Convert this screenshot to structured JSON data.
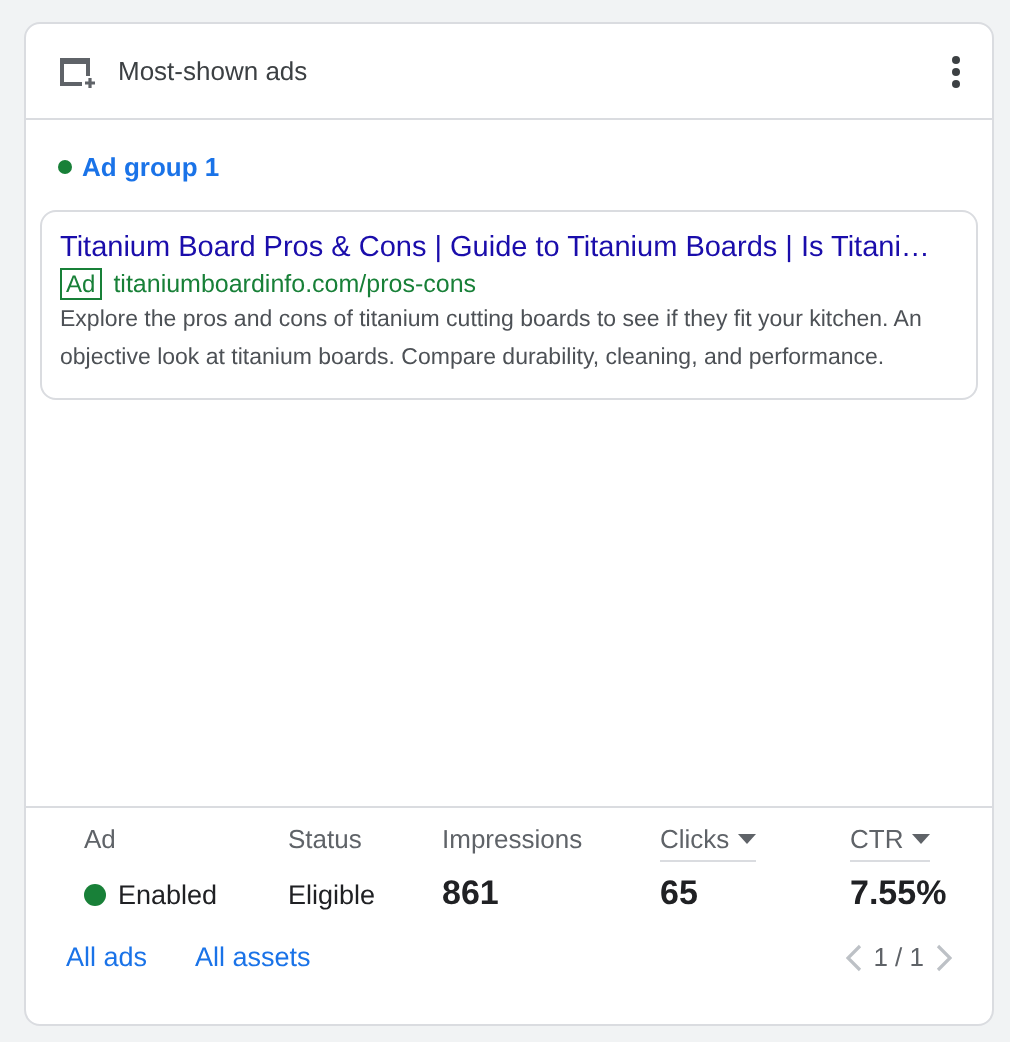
{
  "card": {
    "title": "Most-shown ads"
  },
  "ad_group": {
    "label": "Ad group 1",
    "color": "#188038"
  },
  "ad": {
    "headline": "Titanium Board Pros & Cons | Guide to Titanium Boards | Is Titani…",
    "badge": "Ad",
    "url": "titaniumboardinfo.com/pros-cons",
    "description": "Explore the pros and cons of titanium cutting boards to see if they fit your kitchen. An objective look at titanium boards. Compare durability, cleaning, and performance."
  },
  "columns": [
    {
      "heading": "Ad",
      "value": "Enabled",
      "kind": "status",
      "color": "#188038",
      "sortable": false
    },
    {
      "heading": "Status",
      "value": "Eligible",
      "kind": "text",
      "sortable": false
    },
    {
      "heading": "Impressions",
      "value": "861",
      "kind": "number",
      "sortable": false
    },
    {
      "heading": "Clicks",
      "value": "65",
      "kind": "number",
      "sortable": true
    },
    {
      "heading": "CTR",
      "value": "7.55%",
      "kind": "number",
      "sortable": true
    }
  ],
  "links": [
    "All ads",
    "All assets"
  ],
  "pagination": "1 / 1"
}
